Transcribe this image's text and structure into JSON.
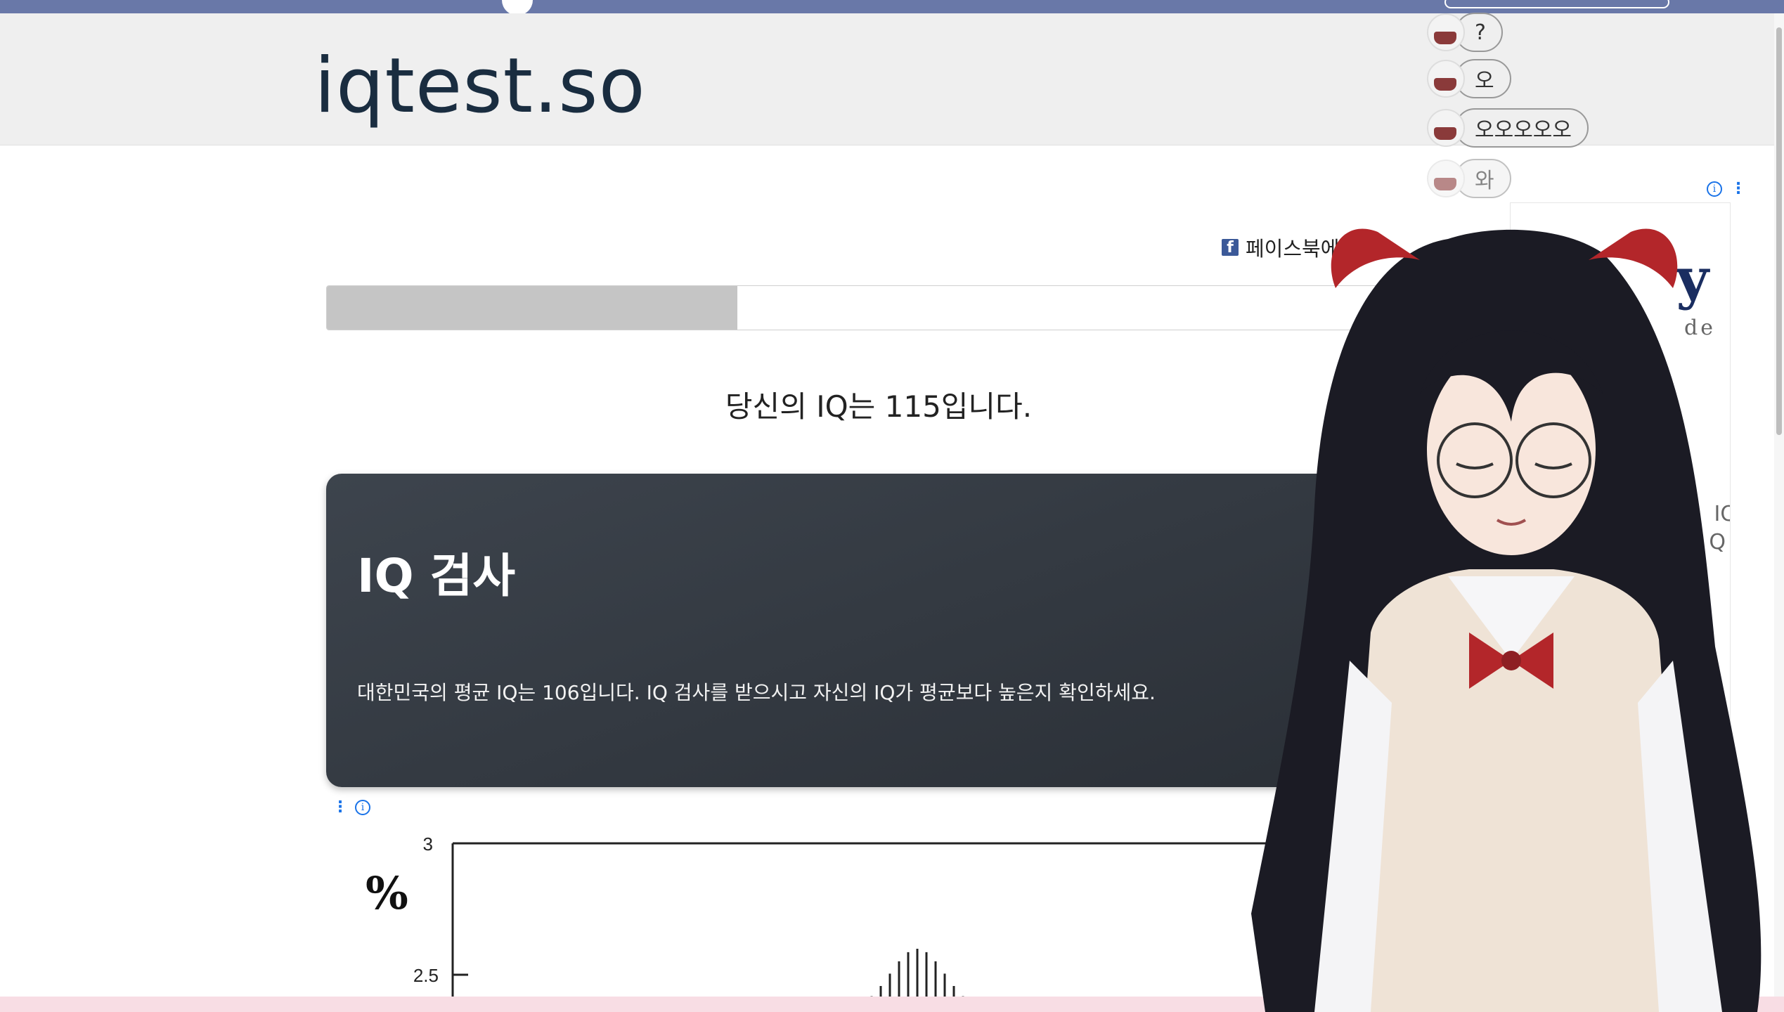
{
  "site": {
    "logo": "iqtest.so"
  },
  "share": {
    "label": "페이스북에 공유"
  },
  "progress": {
    "fraction": 0.384
  },
  "result": {
    "text": "당신의 IQ는 115입니다."
  },
  "card": {
    "title": "IQ 검사",
    "text": "대한민국의 평균 IQ는 106입니다. IQ 검사를 받으시고 자신의 IQ가 평균보다 높은지 확인하세요."
  },
  "chart": {
    "ylabel": "%",
    "ticks": [
      "3",
      "2.5"
    ]
  },
  "side_ad": {
    "big": "y",
    "small": "de",
    "iq1": "IQ",
    "iq2": "Q"
  },
  "chat": [
    {
      "text": "?"
    },
    {
      "text": "오"
    },
    {
      "text": "오오오오오"
    },
    {
      "text": "와"
    }
  ],
  "colors": {
    "topbar": "#6978a8",
    "card": "#2f353c",
    "facebook": "#3b5998",
    "ad_info": "#1a73e8"
  },
  "icons": {
    "facebook": "facebook-icon",
    "ad_info": "info-icon",
    "ad_menu": "more-vert-icon"
  }
}
